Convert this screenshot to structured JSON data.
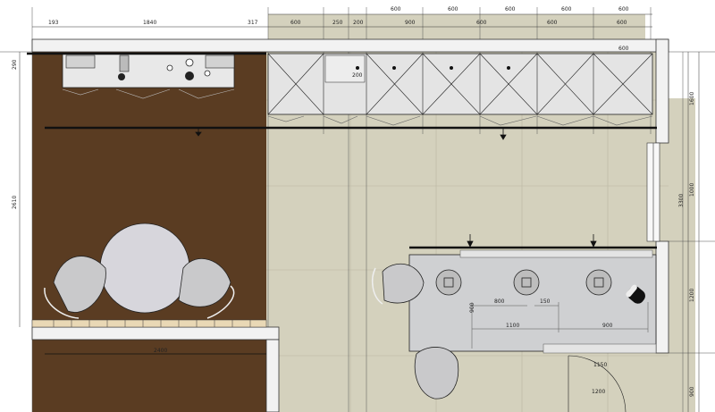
{
  "colors": {
    "wood_floor": "#5a3c22",
    "tile_floor": "#d4d1bd",
    "wall": "#f2f2f2",
    "cabinet": "#e4e4e4",
    "counter": "#cfd0d2",
    "chair": "#c9c9cb",
    "line": "#111111"
  },
  "dimensions": {
    "top_row": [
      "193",
      "1840",
      "317",
      "600",
      "250",
      "200",
      "900",
      "600",
      "600",
      "600"
    ],
    "upper_row": [
      "600",
      "600",
      "600",
      "600",
      "600",
      "600"
    ],
    "left_col": [
      "290",
      "2610"
    ],
    "right_col": [
      "1600",
      "1000",
      "3300",
      "1200",
      "900"
    ],
    "inner": [
      "900",
      "800",
      "150",
      "1100",
      "900",
      "1150",
      "1200",
      "2400",
      "200"
    ]
  }
}
